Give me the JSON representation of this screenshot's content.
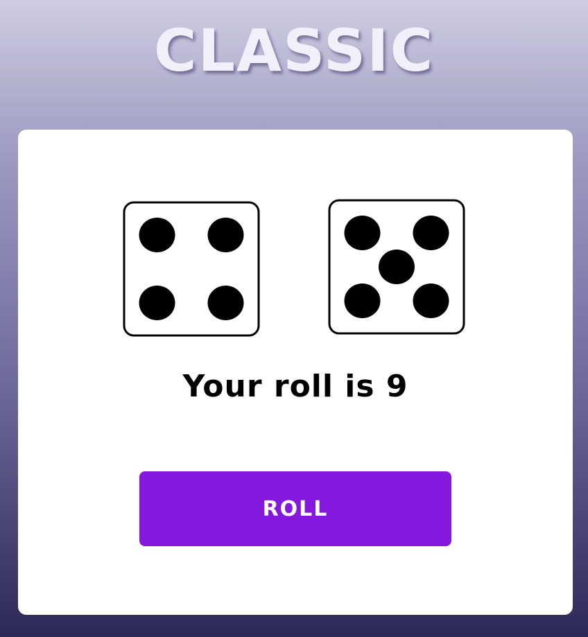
{
  "header": {
    "title": "CLASSIC"
  },
  "dice": [
    {
      "value": 4
    },
    {
      "value": 5
    }
  ],
  "result": {
    "text": "Your roll is 9"
  },
  "controls": {
    "roll_label": "ROLL"
  },
  "colors": {
    "button": "#8419dd",
    "card": "#ffffff",
    "pip": "#000000"
  }
}
